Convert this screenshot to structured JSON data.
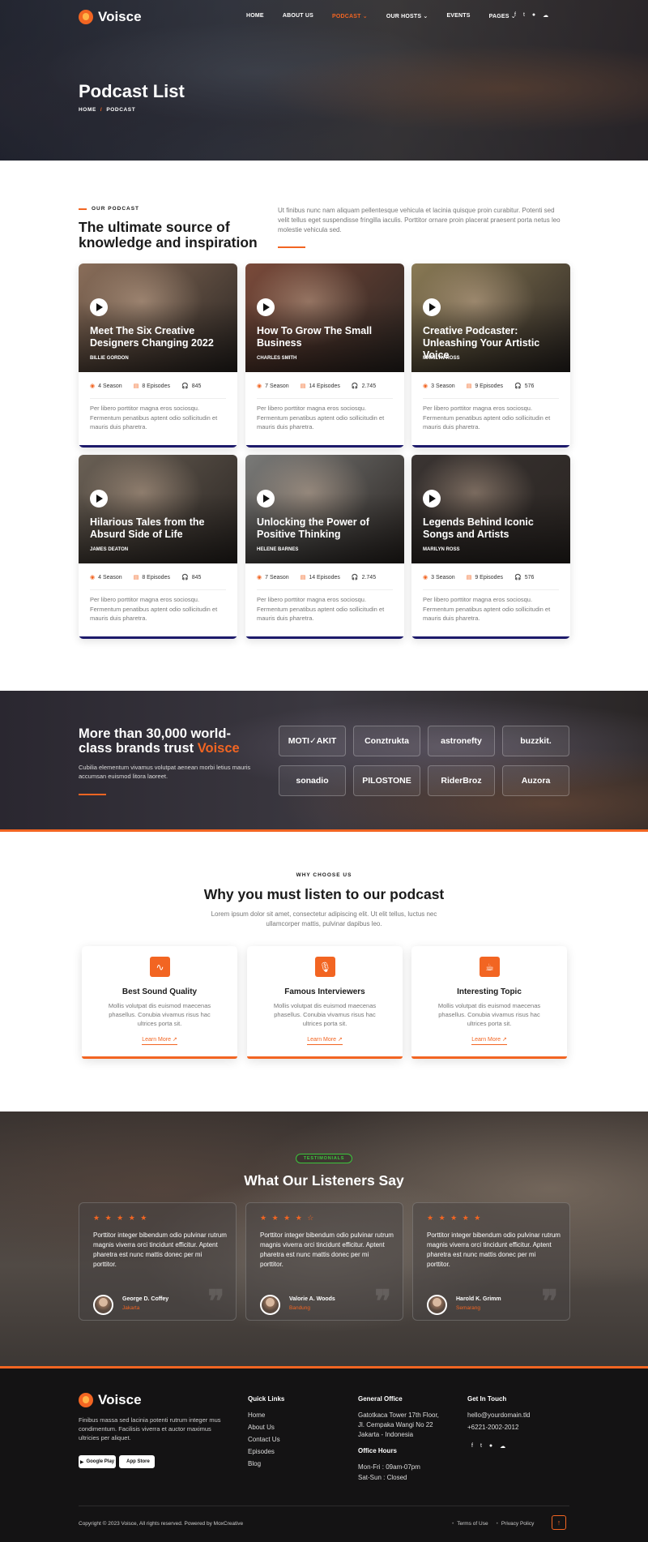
{
  "brand": {
    "name": "Voisce",
    "accent": "#f26522",
    "navy": "#1d1a6b"
  },
  "nav": {
    "items": [
      {
        "label": "HOME"
      },
      {
        "label": "ABOUT US"
      },
      {
        "label": "PODCAST ⌄"
      },
      {
        "label": "OUR HOSTS ⌄"
      },
      {
        "label": "EVENTS"
      },
      {
        "label": "PAGES ⌄"
      }
    ],
    "active_index": 2,
    "social_icons": [
      "facebook-icon",
      "twitter-icon",
      "whatsapp-icon",
      "soundcloud-icon"
    ]
  },
  "hero": {
    "title": "Podcast List",
    "breadcrumb": [
      "HOME",
      "PODCAST"
    ],
    "breadcrumb_sep": "/"
  },
  "podcast_section": {
    "eyebrow": "OUR PODCAST",
    "title": "The ultimate source of knowledge and inspiration",
    "text": "Ut finibus nunc nam aliquam pellentesque vehicula et lacinia quisque proin curabitur. Potenti sed velit tellus eget suspendisse fringilla iaculis. Porttitor ornare proin placerat praesent porta netus leo molestie vehicula sed."
  },
  "podcasts": [
    {
      "title": "Meet The Six Creative Designers Changing 2022",
      "author": "BILLIE GORDON",
      "season": "4 Season",
      "episodes": "8 Episodes",
      "listens": "845",
      "desc": "Per libero porttitor magna eros sociosqu. Fermentum penatibus aptent odio sollicitudin et mauris duis pharetra.",
      "tone": "#8a6e5a"
    },
    {
      "title": "How To Grow The Small Business",
      "author": "CHARLES SMITH",
      "season": "7 Season",
      "episodes": "14 Episodes",
      "listens": "2.745",
      "desc": "Per libero porttitor magna eros sociosqu. Fermentum penatibus aptent odio sollicitudin et mauris duis pharetra.",
      "tone": "#7a4a3a"
    },
    {
      "title": "Creative Podcaster: Unleashing Your Artistic Voice",
      "author": "MARILYN ROSS",
      "season": "3 Season",
      "episodes": "9 Episodes",
      "listens": "576",
      "desc": "Per libero porttitor magna eros sociosqu. Fermentum penatibus aptent odio sollicitudin et mauris duis pharetra.",
      "tone": "#8a7a55"
    },
    {
      "title": "Hilarious Tales from the Absurd Side of Life",
      "author": "JAMES DEATON",
      "season": "4 Season",
      "episodes": "8 Episodes",
      "listens": "845",
      "desc": "Per libero porttitor magna eros sociosqu. Fermentum penatibus aptent odio sollicitudin et mauris duis pharetra.",
      "tone": "#6a6055"
    },
    {
      "title": "Unlocking the Power of Positive Thinking",
      "author": "HELENE BARNES",
      "season": "7 Season",
      "episodes": "14 Episodes",
      "listens": "2.745",
      "desc": "Per libero porttitor magna eros sociosqu. Fermentum penatibus aptent odio sollicitudin et mauris duis pharetra.",
      "tone": "#7a7a78"
    },
    {
      "title": "Legends Behind Iconic Songs and Artists",
      "author": "MARILYN ROSS",
      "season": "3 Season",
      "episodes": "9 Episodes",
      "listens": "576",
      "desc": "Per libero porttitor magna eros sociosqu. Fermentum penatibus aptent odio sollicitudin et mauris duis pharetra.",
      "tone": "#3a3432"
    }
  ],
  "brands_section": {
    "title_pre": "More than 30,000 world-class brands trust ",
    "title_accent": "Voisce",
    "text": "Cubilia elementum vivamus volutpat aenean morbi letius mauris accumsan euismod litora laoreet.",
    "logos": [
      "MOTI✓AKIT",
      "Conztrukta",
      "astronefty",
      "buzzkit.",
      "sonadio",
      "PILOSTONE",
      "RiderBroz",
      "Auzora"
    ]
  },
  "why": {
    "eyebrow": "WHY CHOOSE US",
    "title": "Why you must listen to our podcast",
    "text": "Lorem ipsum dolor sit amet, consectetur adipiscing elit. Ut elit tellus, luctus nec ullamcorper mattis, pulvinar dapibus leo.",
    "features": [
      {
        "icon": "soundwave-icon",
        "glyph": "∿",
        "title": "Best Sound Quality",
        "desc": "Mollis volutpat dis euismod maecenas phasellus. Conubia vivamus risus hac ultrices porta sit.",
        "link": "Learn More ↗"
      },
      {
        "icon": "microphone-icon",
        "glyph": "🎙",
        "title": "Famous Interviewers",
        "desc": "Mollis volutpat dis euismod maecenas phasellus. Conubia vivamus risus hac ultrices porta sit.",
        "link": "Learn More ↗"
      },
      {
        "icon": "coffee-cup-icon",
        "glyph": "☕",
        "title": "Interesting Topic",
        "desc": "Mollis volutpat dis euismod maecenas phasellus. Conubia vivamus risus hac ultrices porta sit.",
        "link": "Learn More ↗"
      }
    ]
  },
  "testimonials": {
    "badge": "TESTIMONIALS",
    "title": "What Our Listeners Say",
    "items": [
      {
        "stars": "★ ★ ★ ★ ★",
        "rating": 5,
        "quote": "Porttitor integer bibendum odio pulvinar rutrum magnis viverra orci tincidunt efficitur. Aptent pharetra est nunc mattis donec per mi porttitor.",
        "name": "George D. Coffey",
        "location": "Jakarta"
      },
      {
        "stars": "★ ★ ★ ★ ☆",
        "rating": 4,
        "quote": "Porttitor integer bibendum odio pulvinar rutrum magnis viverra orci tincidunt efficitur. Aptent pharetra est nunc mattis donec per mi porttitor.",
        "name": "Valorie A. Woods",
        "location": "Bandung"
      },
      {
        "stars": "★ ★ ★ ★ ★",
        "rating": 5,
        "quote": "Porttitor integer bibendum odio pulvinar rutrum magnis viverra orci tincidunt efficitur. Aptent pharetra est nunc mattis donec per mi porttitor.",
        "name": "Harold K. Grimm",
        "location": "Semarang"
      }
    ]
  },
  "footer": {
    "about": "Finibus massa sed lacinia potenti rutrum integer mus condimentum. Facilisis viverra et auctor maximus ultricies per aliquet.",
    "google_play": "Google Play",
    "app_store": "App Store",
    "quick_links_title": "Quick Links",
    "quick_links": [
      "Home",
      "About Us",
      "Contact Us",
      "Episodes",
      "Blog"
    ],
    "office_title": "General Office",
    "office_lines": [
      "Gatotkaca Tower 17th Floor,",
      "Jl. Cempaka Wangi No 22",
      "Jakarta - Indonesia"
    ],
    "hours_title": "Office Hours",
    "hours": [
      "Mon-Fri : 09am-07pm",
      "Sat-Sun : Closed"
    ],
    "touch_title": "Get In Touch",
    "email": "hello@yourdomain.tld",
    "phone": "+6221-2002-2012",
    "copyright": "Copyright © 2023 Voisce, All rights reserved. Powered by MoxCreative",
    "legal": [
      "Terms of Use",
      "Privacy Policy"
    ],
    "back_to_top": "↑"
  }
}
